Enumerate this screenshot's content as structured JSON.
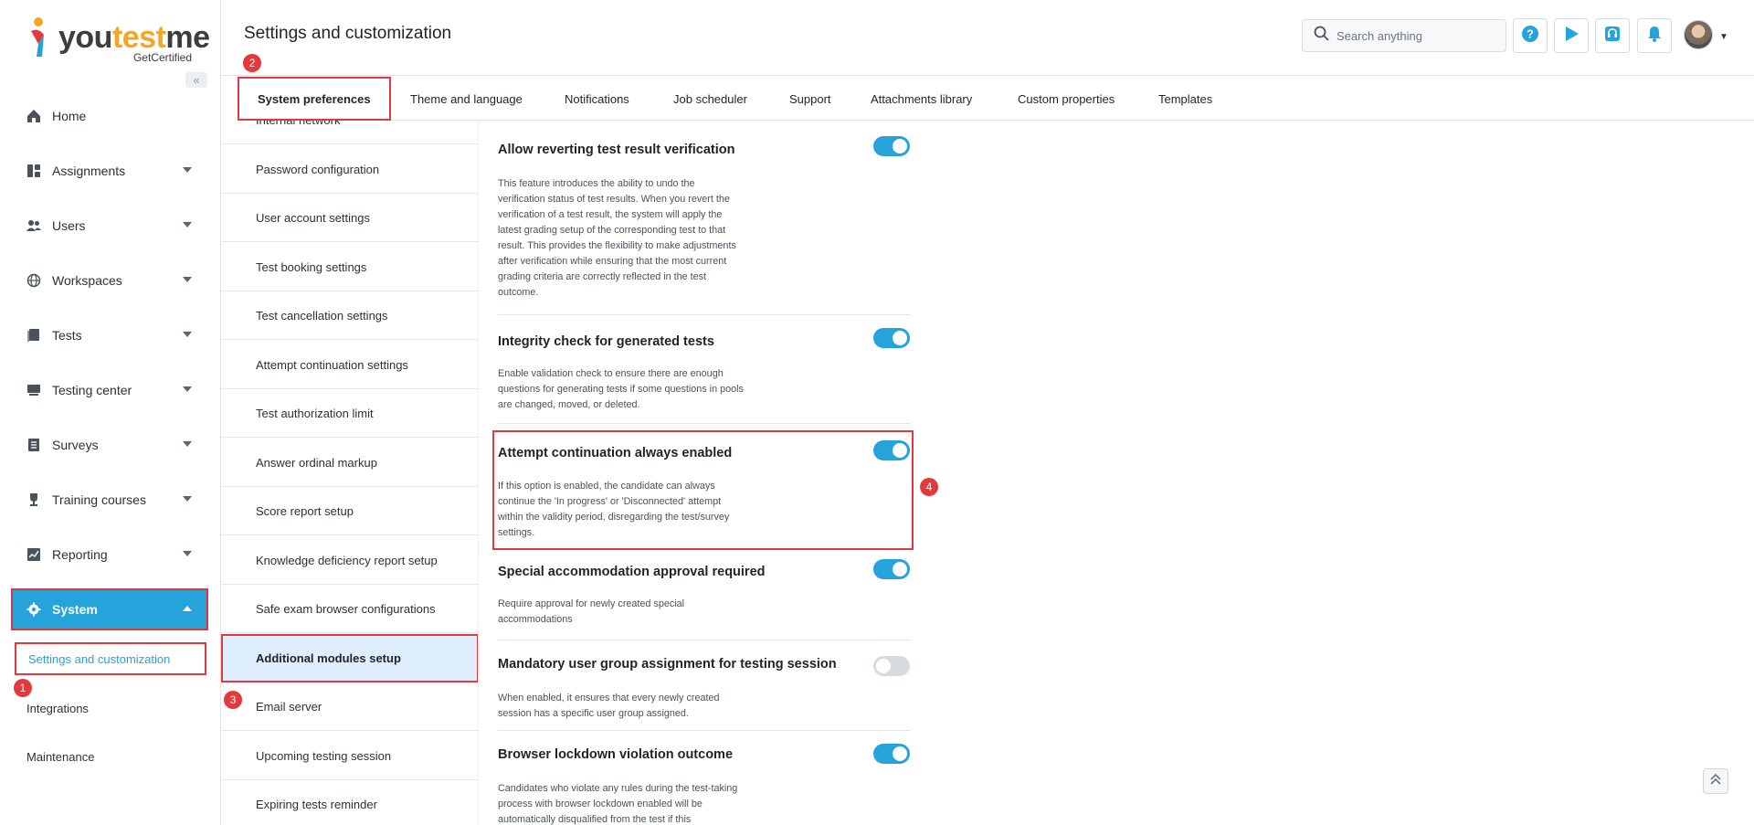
{
  "app": {
    "logo_main": "youtestme",
    "logo_accent_part": "test",
    "logo_sub": "GetCertified",
    "brand_color": "#27a3dc"
  },
  "header": {
    "page_title": "Settings and customization",
    "search_placeholder": "Search anything",
    "buttons": [
      "help-icon",
      "play-icon",
      "support-headset-icon",
      "bell-icon"
    ]
  },
  "sidebar": {
    "items": [
      {
        "label": "Home",
        "icon": "home-icon"
      },
      {
        "label": "Assignments",
        "icon": "assignments-icon"
      },
      {
        "label": "Users",
        "icon": "users-icon"
      },
      {
        "label": "Workspaces",
        "icon": "globe-icon"
      },
      {
        "label": "Tests",
        "icon": "tests-icon"
      },
      {
        "label": "Testing center",
        "icon": "testing-center-icon"
      },
      {
        "label": "Surveys",
        "icon": "surveys-icon"
      },
      {
        "label": "Training courses",
        "icon": "trophy-icon"
      },
      {
        "label": "Reporting",
        "icon": "reporting-icon"
      },
      {
        "label": "System",
        "icon": "gear-icon"
      }
    ],
    "sub_items": [
      "Settings and customization",
      "Integrations",
      "Maintenance"
    ]
  },
  "tabs": [
    "System preferences",
    "Theme and language",
    "Notifications",
    "Job scheduler",
    "Support",
    "Attachments library",
    "Custom properties",
    "Templates"
  ],
  "mid_list": [
    "Internal network",
    "Password configuration",
    "User account settings",
    "Test booking settings",
    "Test cancellation settings",
    "Attempt continuation settings",
    "Test authorization limit",
    "Answer ordinal markup",
    "Score report setup",
    "Knowledge deficiency report setup",
    "Safe exam browser configurations",
    "Additional modules setup",
    "Email server",
    "Upcoming testing session",
    "Expiring tests reminder"
  ],
  "markers": [
    "1",
    "2",
    "3",
    "4"
  ],
  "settings": [
    {
      "title": "Allow reverting test result verification",
      "enabled": true,
      "description": "This feature introduces the ability to undo the verification status of test results. When you revert the verification of a test result, the system will apply the latest grading setup of the corresponding test to that result. This provides the flexibility to make adjustments after verification while ensuring that the most current grading criteria are correctly reflected in the test outcome."
    },
    {
      "title": "Integrity check for generated tests",
      "enabled": true,
      "description": "Enable validation check to ensure there are enough questions for generating tests if some questions in pools are changed, moved, or deleted."
    },
    {
      "title": "Attempt continuation always enabled",
      "enabled": true,
      "description": "If this option is enabled, the candidate can always continue the 'In progress' or 'Disconnected' attempt within the validity period, disregarding the test/survey settings."
    },
    {
      "title": "Special accommodation approval required",
      "enabled": true,
      "description": "Require approval for newly created special accommodations"
    },
    {
      "title": "Mandatory user group assignment for testing session",
      "enabled": false,
      "description": "When enabled, it ensures that every newly created session has a specific user group assigned."
    },
    {
      "title": "Browser lockdown violation outcome",
      "enabled": true,
      "description": "Candidates who violate any rules during the test-taking process with browser lockdown enabled will be automatically disqualified from the test if this"
    }
  ]
}
